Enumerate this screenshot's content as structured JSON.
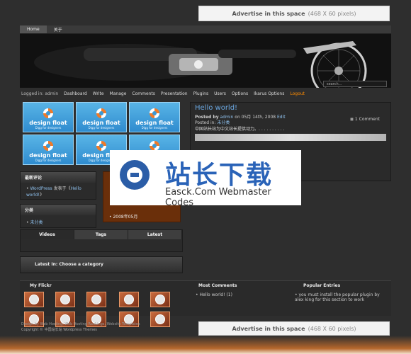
{
  "ad_top": {
    "title": "Advertise in this space",
    "dims": "(468 X 60 pixels)"
  },
  "ad_bottom": {
    "title": "Advertise in this space",
    "dims": "(468 X 60 pixels)"
  },
  "nav": {
    "tabs": [
      "Home",
      "关于"
    ],
    "search_placeholder": "search..."
  },
  "adminbar": {
    "logged_in": "Logged in: admin",
    "items": [
      "Dashboard",
      "Write",
      "Manage",
      "Comments",
      "Presentation",
      "Plugins",
      "Users",
      "Options",
      "Ikarus Options"
    ],
    "logout": "Logout"
  },
  "thumbnails": {
    "title": "design float",
    "subtitle": "Digg for designers"
  },
  "post": {
    "title": "Hello world!",
    "meta_posted_by": "Posted by",
    "meta_author": "admin",
    "meta_date": "on 05月 14th, 2008",
    "meta_edit": "Edit",
    "meta_posted_in": "Posted in:",
    "meta_category": "未分类",
    "comments": "1 Comment",
    "body": "中国站长站为中文站长提供动力。. . . . . . . . . ."
  },
  "widgets": {
    "recent_comments_title": "最新评论",
    "recent_comment_author": "WordPress",
    "recent_comment_text": "发表于《",
    "recent_comment_link": "Hello world!",
    "recent_comment_close": "》",
    "categories_title": "分类",
    "category": "未分类",
    "archive": "2008年05月"
  },
  "tabs3": [
    "Videos",
    "Tags",
    "Latest"
  ],
  "latest_in": "Latest In: Choose a category",
  "footer": {
    "flickr_title": "My Flickr",
    "most_comments_title": "Most Comments",
    "most_comments_item": "Hello world! (1)",
    "popular_title": "Popular Entries",
    "popular_text": "you must install the popular plugin by alex king for this section to work",
    "credit": "Design by Web Hosting, Web Hosting Rankings, Website Templates",
    "copyright": "Copyright © 中国站长站 Wordpress Themes"
  },
  "watermark": {
    "title": "站长下载",
    "subtitle": "Easck.Com Webmaster Codes"
  }
}
